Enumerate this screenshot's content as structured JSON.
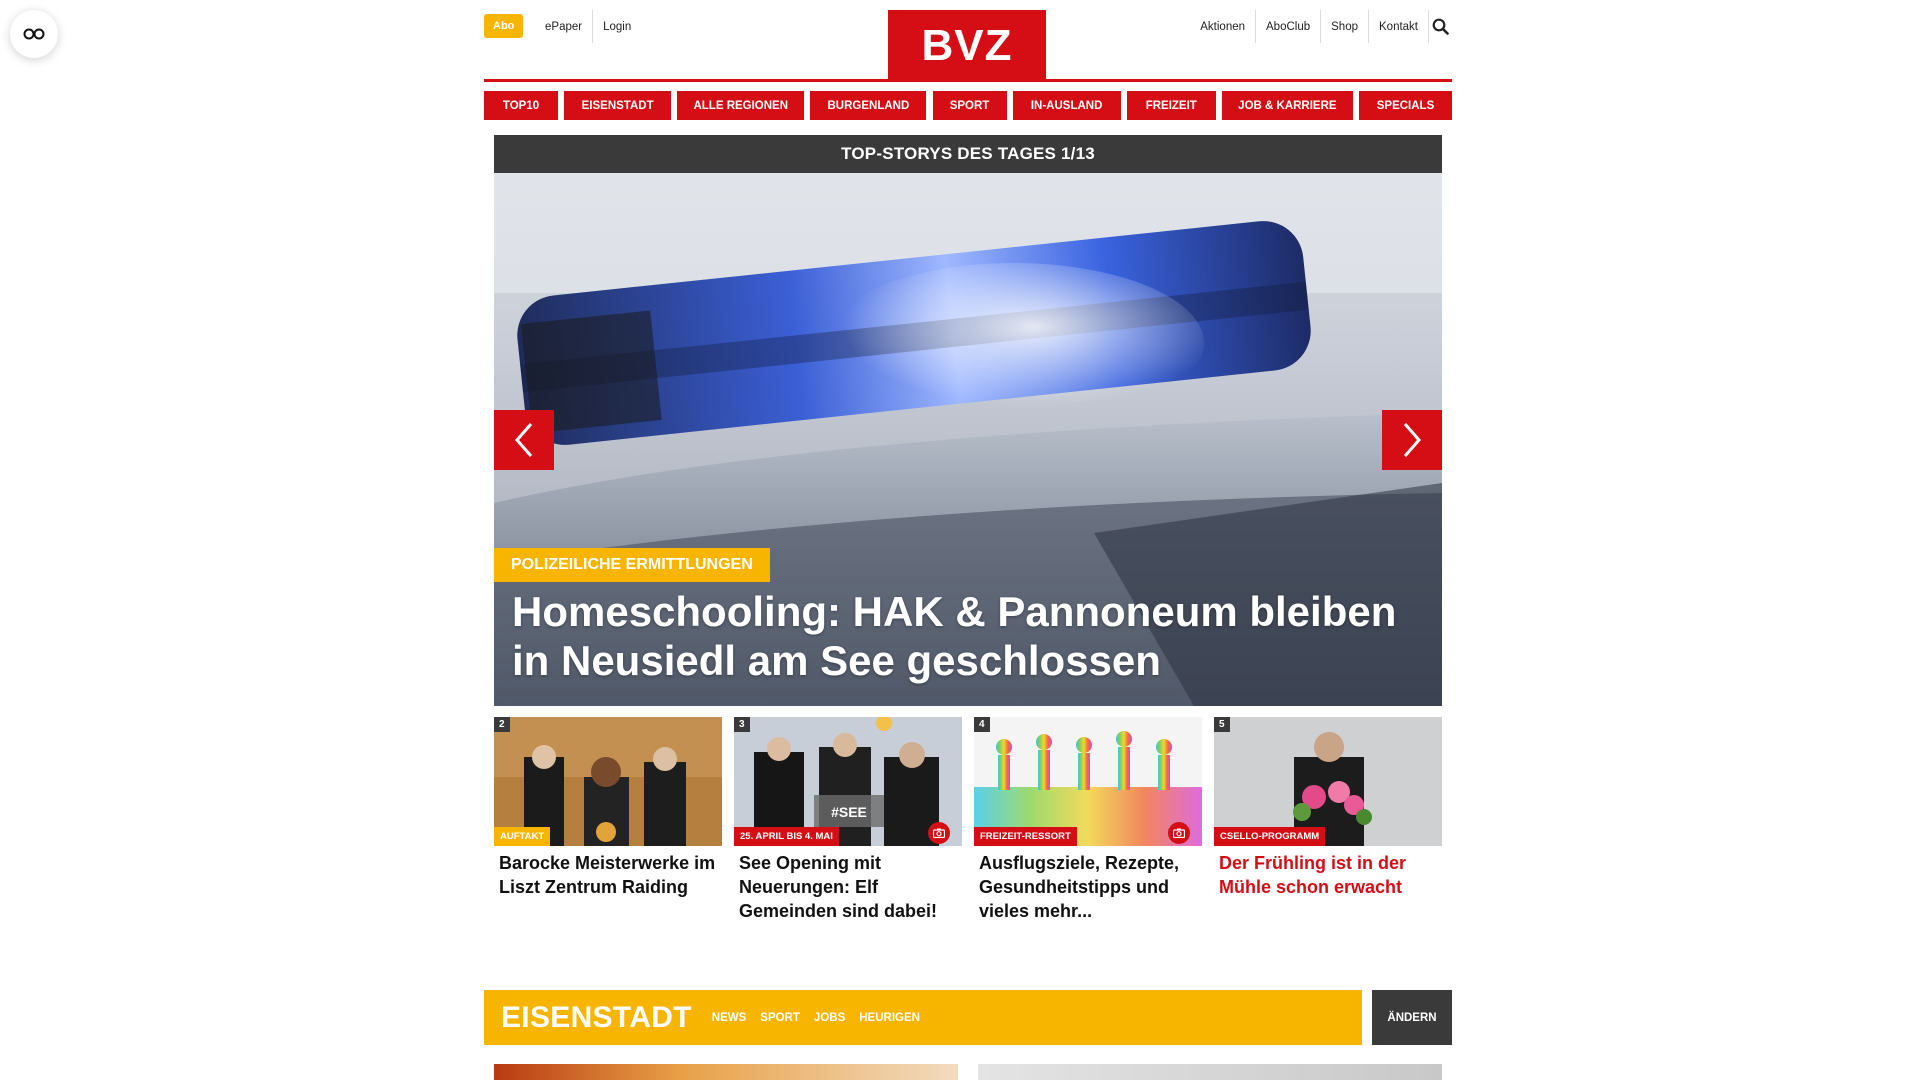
{
  "header": {
    "abo_label": "Abo",
    "links_left": [
      "ePaper",
      "Login"
    ],
    "logo_text": "BVZ",
    "links_right": [
      "Aktionen",
      "AboClub",
      "Shop",
      "Kontakt"
    ],
    "search_icon": "search-icon"
  },
  "nav": {
    "items": [
      "TOP10",
      "EISENSTADT",
      "ALLE REGIONEN",
      "BURGENLAND",
      "SPORT",
      "IN-AUSLAND",
      "FREIZEIT",
      "JOB & KARRIERE",
      "SPECIALS"
    ]
  },
  "top_stories": {
    "heading": "TOP-STORYS DES TAGES 1/13",
    "hero": {
      "kicker": "POLIZEILICHE ERMITTLUNGEN",
      "title": "Homeschooling: HAK & Pannoneum bleiben in Neusiedl am See geschlossen"
    },
    "teasers": [
      {
        "num": "2",
        "kicker": "AUFTAKT",
        "kicker_color": "#f7b500",
        "title": "Barocke Meisterwerke im Liszt Zentrum Raiding",
        "gallery": false,
        "title_red": false
      },
      {
        "num": "3",
        "kicker": "25. APRIL BIS 4. MAI",
        "kicker_color": "#d40e14",
        "title": "See Opening mit Neuerungen: Elf Gemeinden sind dabei!",
        "gallery": true,
        "title_red": false
      },
      {
        "num": "4",
        "kicker": "FREIZEIT-RESSORT",
        "kicker_color": "#d40e14",
        "title": "Ausflugsziele, Rezepte, Gesundheitstipps und vieles mehr...",
        "gallery": true,
        "title_red": false
      },
      {
        "num": "5",
        "kicker": "CSELLO-PROGRAMM",
        "kicker_color": "#d40e14",
        "title": "Der Frühling ist in der Mühle schon erwacht",
        "gallery": false,
        "title_red": true
      }
    ]
  },
  "region": {
    "title": "EISENSTADT",
    "links": [
      "NEWS",
      "SPORT",
      "JOBS",
      "HEURIGEN"
    ],
    "change_label": "ÄNDERN"
  },
  "colors": {
    "brand_red": "#d40e14",
    "accent_yellow": "#f7b500",
    "dark_grey": "#3a3a3a"
  }
}
